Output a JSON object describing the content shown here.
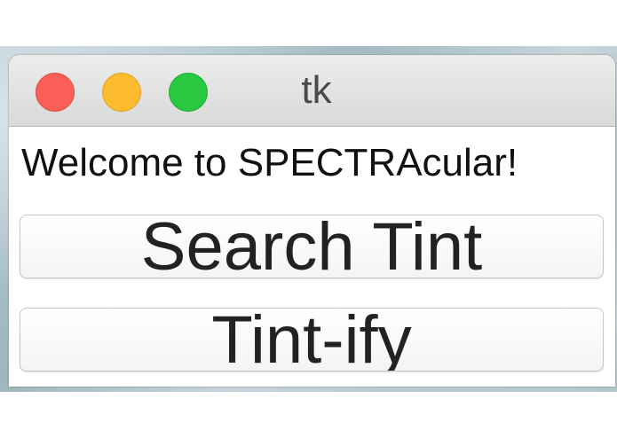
{
  "window": {
    "title": "tk",
    "controls": {
      "close_color": "#fc5f57",
      "minimize_color": "#fdbc2e",
      "maximize_color": "#28c840"
    }
  },
  "content": {
    "welcome_text": "Welcome to SPECTRAcular!",
    "buttons": [
      {
        "label": "Search Tint"
      },
      {
        "label": "Tint-ify"
      }
    ]
  }
}
